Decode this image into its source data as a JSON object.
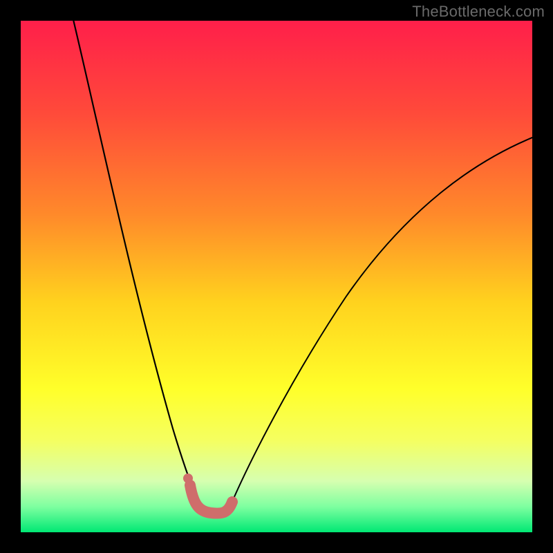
{
  "watermark": "TheBottleneck.com",
  "colors": {
    "black": "#000000",
    "curve": "#000000",
    "marker": "#cf6d6b",
    "gradient_stops": [
      {
        "offset": 0.0,
        "color": "#ff1f4a"
      },
      {
        "offset": 0.18,
        "color": "#ff4a3a"
      },
      {
        "offset": 0.38,
        "color": "#ff8a2a"
      },
      {
        "offset": 0.55,
        "color": "#ffd21e"
      },
      {
        "offset": 0.72,
        "color": "#ffff2a"
      },
      {
        "offset": 0.82,
        "color": "#f5ff60"
      },
      {
        "offset": 0.9,
        "color": "#d6ffb0"
      },
      {
        "offset": 0.95,
        "color": "#7effa0"
      },
      {
        "offset": 1.0,
        "color": "#00e874"
      }
    ]
  },
  "chart_data": {
    "type": "line",
    "title": "",
    "xlabel": "",
    "ylabel": "",
    "xlim": [
      0,
      100
    ],
    "ylim": [
      0,
      100
    ],
    "series": [
      {
        "name": "left-curve",
        "x": [
          10,
          12,
          14,
          16,
          18,
          20,
          22,
          24,
          26,
          28,
          30,
          32,
          33,
          34,
          35
        ],
        "y": [
          100,
          92,
          84,
          75,
          66,
          57,
          48,
          40,
          32,
          25,
          18,
          12,
          9,
          7,
          6
        ]
      },
      {
        "name": "right-curve",
        "x": [
          40,
          42,
          45,
          48,
          52,
          56,
          60,
          65,
          70,
          76,
          82,
          88,
          94,
          100
        ],
        "y": [
          6,
          8,
          12,
          17,
          24,
          31,
          38,
          46,
          53,
          60,
          66,
          71,
          75,
          78
        ]
      },
      {
        "name": "valley-markers",
        "x": [
          33,
          34,
          35,
          36,
          37,
          38,
          39,
          40,
          41
        ],
        "y": [
          9,
          7,
          6,
          5.5,
          5.5,
          5.5,
          6,
          6.5,
          7.5
        ]
      }
    ],
    "annotations": []
  }
}
